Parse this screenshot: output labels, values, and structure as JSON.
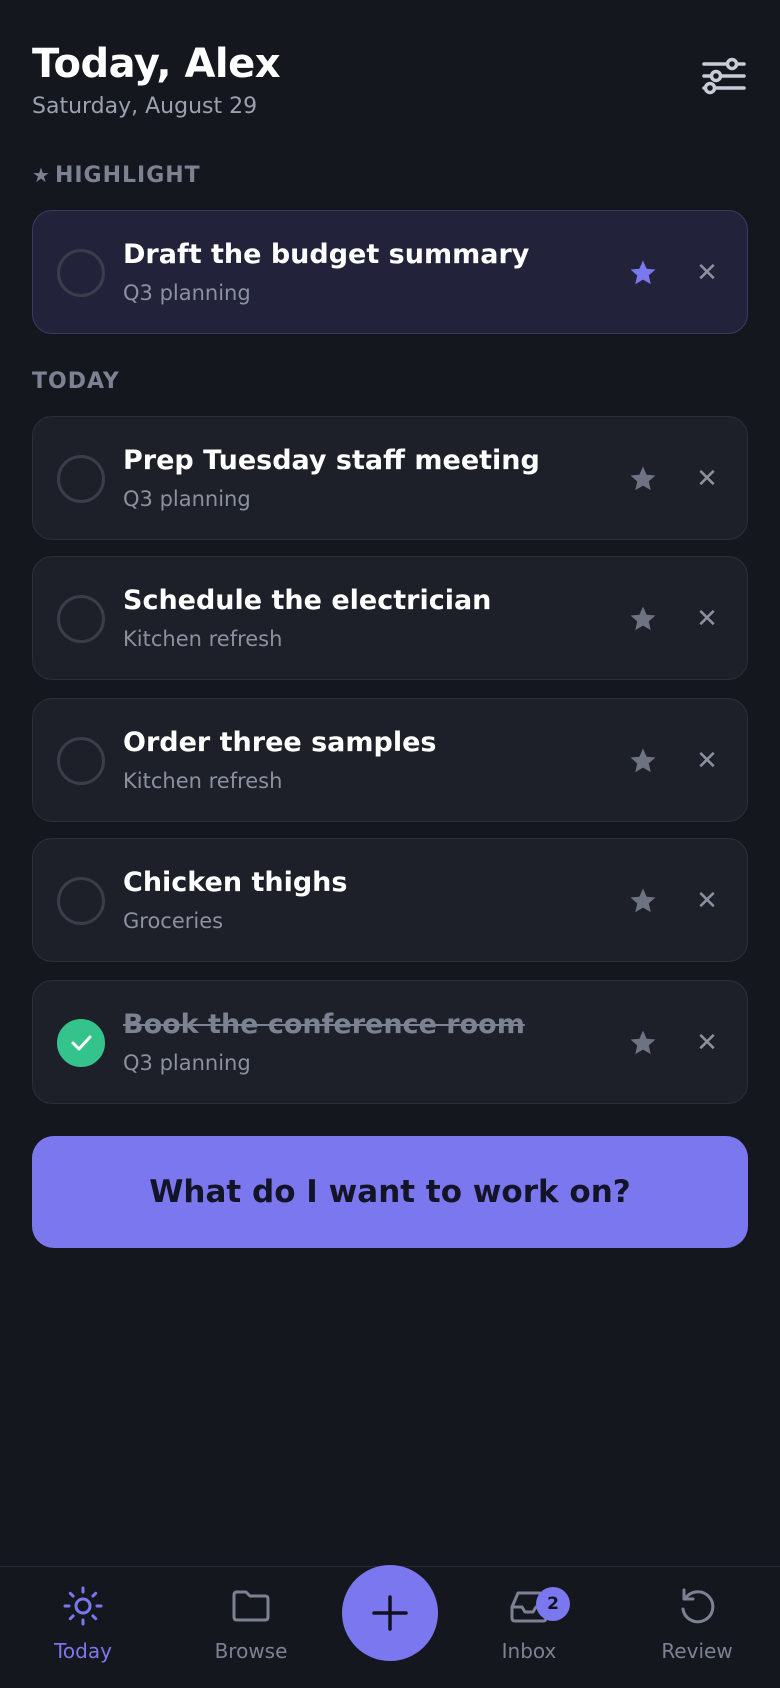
{
  "header": {
    "title": "Today, Alex",
    "date": "Saturday, August 29",
    "settings_icon": "sliders-icon"
  },
  "sections": {
    "highlight_label": "HIGHLIGHT",
    "today_label": "TODAY"
  },
  "highlight_task": {
    "title": "Draft the budget summary",
    "project": "Q3 planning",
    "starred": true,
    "done": false
  },
  "tasks": [
    {
      "title": "Prep Tuesday staff meeting",
      "project": "Q3 planning",
      "starred": false,
      "done": false
    },
    {
      "title": "Schedule the electrician",
      "project": "Kitchen refresh",
      "starred": false,
      "done": false
    },
    {
      "title": "Order three samples",
      "project": "Kitchen refresh",
      "starred": false,
      "done": false
    },
    {
      "title": "Chicken thighs",
      "project": "Groceries",
      "starred": false,
      "done": false
    },
    {
      "title": "Book the conference room",
      "project": "Q3 planning",
      "starred": false,
      "done": true
    }
  ],
  "cta": {
    "label": "What do I want to work on?"
  },
  "nav": {
    "items": [
      {
        "label": "Today",
        "icon": "sun-icon",
        "active": true
      },
      {
        "label": "Browse",
        "icon": "folder-icon",
        "active": false
      },
      {
        "label": "Inbox",
        "icon": "inbox-icon",
        "active": false,
        "badge": "2"
      },
      {
        "label": "Review",
        "icon": "refresh-icon",
        "active": false
      }
    ],
    "add_icon": "plus-icon"
  },
  "colors": {
    "background": "#15171f",
    "accent": "#7b78ef",
    "success": "#34c38b",
    "muted": "#7d8293"
  }
}
